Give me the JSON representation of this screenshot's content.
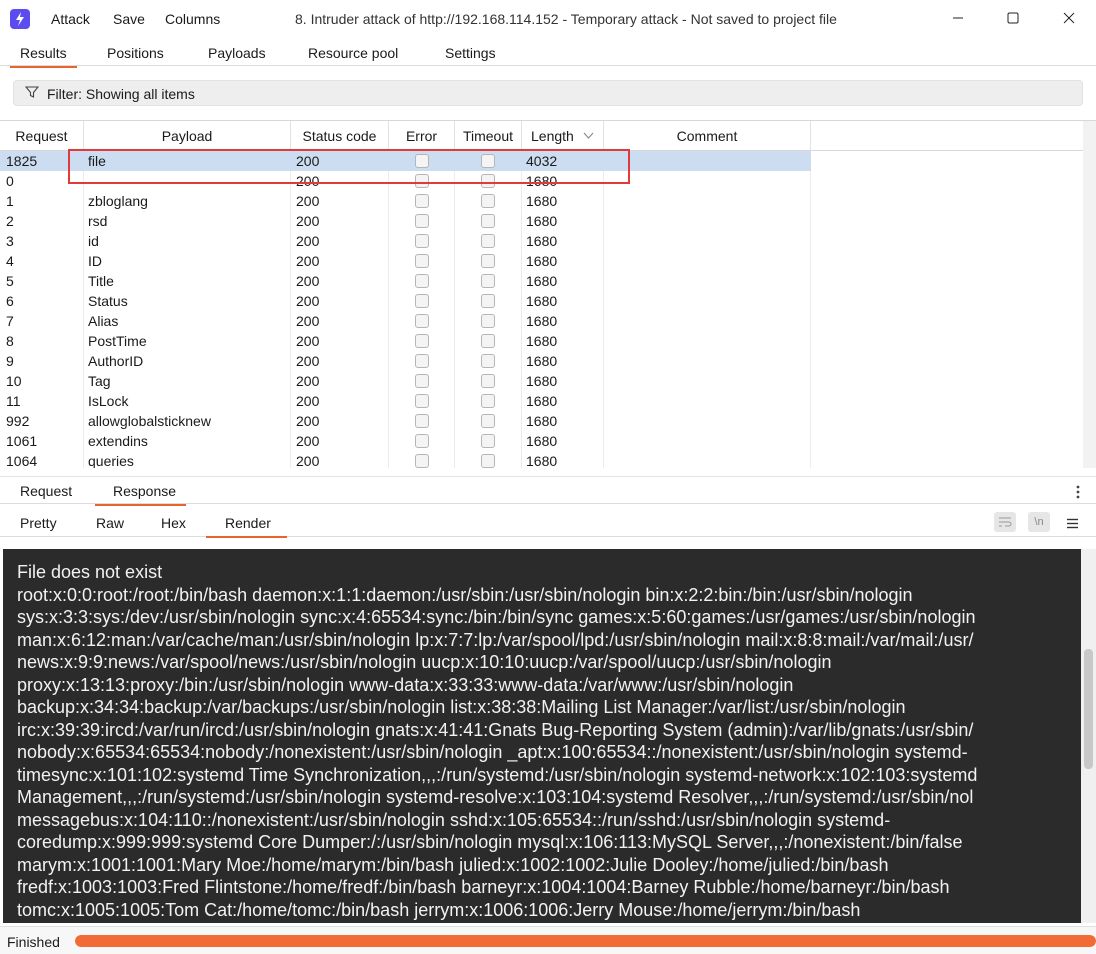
{
  "menu": {
    "attack": "Attack",
    "save": "Save",
    "columns": "Columns"
  },
  "window_title": "8. Intruder attack of http://192.168.114.152 - Temporary attack - Not saved to project file",
  "tabs": [
    "Results",
    "Positions",
    "Payloads",
    "Resource pool",
    "Settings"
  ],
  "active_tab": "Results",
  "filter": {
    "label": "Filter: Showing all items"
  },
  "table": {
    "columns": [
      "Request",
      "Payload",
      "Status code",
      "Error",
      "Timeout",
      "Length",
      "Comment"
    ],
    "sort_column": "Length",
    "rows": [
      {
        "request": "1825",
        "payload": "file",
        "status": "200",
        "length": "4032",
        "selected": true
      },
      {
        "request": "0",
        "payload": "",
        "status": "200",
        "length": "1680"
      },
      {
        "request": "1",
        "payload": "zbloglang",
        "status": "200",
        "length": "1680"
      },
      {
        "request": "2",
        "payload": "rsd",
        "status": "200",
        "length": "1680"
      },
      {
        "request": "3",
        "payload": "id",
        "status": "200",
        "length": "1680"
      },
      {
        "request": "4",
        "payload": "ID",
        "status": "200",
        "length": "1680"
      },
      {
        "request": "5",
        "payload": "Title",
        "status": "200",
        "length": "1680"
      },
      {
        "request": "6",
        "payload": "Status",
        "status": "200",
        "length": "1680"
      },
      {
        "request": "7",
        "payload": "Alias",
        "status": "200",
        "length": "1680"
      },
      {
        "request": "8",
        "payload": "PostTime",
        "status": "200",
        "length": "1680"
      },
      {
        "request": "9",
        "payload": "AuthorID",
        "status": "200",
        "length": "1680"
      },
      {
        "request": "10",
        "payload": "Tag",
        "status": "200",
        "length": "1680"
      },
      {
        "request": "11",
        "payload": "IsLock",
        "status": "200",
        "length": "1680"
      },
      {
        "request": "992",
        "payload": "allowglobalsticknew",
        "status": "200",
        "length": "1680"
      },
      {
        "request": "1061",
        "payload": "extendins",
        "status": "200",
        "length": "1680"
      },
      {
        "request": "1064",
        "payload": "queries",
        "status": "200",
        "length": "1680"
      }
    ]
  },
  "message_tabs": [
    "Request",
    "Response"
  ],
  "active_message_tab": "Response",
  "view_tabs": [
    "Pretty",
    "Raw",
    "Hex",
    "Render"
  ],
  "active_view_tab": "Render",
  "toolbar": {
    "newline_label": "\\n"
  },
  "render_lines": [
    "File does not exist",
    "root:x:0:0:root:/root:/bin/bash daemon:x:1:1:daemon:/usr/sbin:/usr/sbin/nologin bin:x:2:2:bin:/bin:/usr/sbin/nologin",
    "sys:x:3:3:sys:/dev:/usr/sbin/nologin sync:x:4:65534:sync:/bin:/bin/sync games:x:5:60:games:/usr/games:/usr/sbin/nologin",
    "man:x:6:12:man:/var/cache/man:/usr/sbin/nologin lp:x:7:7:lp:/var/spool/lpd:/usr/sbin/nologin mail:x:8:8:mail:/var/mail:/usr/",
    "news:x:9:9:news:/var/spool/news:/usr/sbin/nologin uucp:x:10:10:uucp:/var/spool/uucp:/usr/sbin/nologin",
    "proxy:x:13:13:proxy:/bin:/usr/sbin/nologin www-data:x:33:33:www-data:/var/www:/usr/sbin/nologin",
    "backup:x:34:34:backup:/var/backups:/usr/sbin/nologin list:x:38:38:Mailing List Manager:/var/list:/usr/sbin/nologin",
    "irc:x:39:39:ircd:/var/run/ircd:/usr/sbin/nologin gnats:x:41:41:Gnats Bug-Reporting System (admin):/var/lib/gnats:/usr/sbin/",
    "nobody:x:65534:65534:nobody:/nonexistent:/usr/sbin/nologin _apt:x:100:65534::/nonexistent:/usr/sbin/nologin systemd-",
    "timesync:x:101:102:systemd Time Synchronization,,,:/run/systemd:/usr/sbin/nologin systemd-network:x:102:103:systemd",
    "Management,,,:/run/systemd:/usr/sbin/nologin systemd-resolve:x:103:104:systemd Resolver,,,:/run/systemd:/usr/sbin/nol",
    "messagebus:x:104:110::/nonexistent:/usr/sbin/nologin sshd:x:105:65534::/run/sshd:/usr/sbin/nologin systemd-",
    "coredump:x:999:999:systemd Core Dumper:/:/usr/sbin/nologin mysql:x:106:113:MySQL Server,,,:/nonexistent:/bin/false",
    "marym:x:1001:1001:Mary Moe:/home/marym:/bin/bash julied:x:1002:1002:Julie Dooley:/home/julied:/bin/bash",
    "fredf:x:1003:1003:Fred Flintstone:/home/fredf:/bin/bash barneyr:x:1004:1004:Barney Rubble:/home/barneyr:/bin/bash",
    "tomc:x:1005:1005:Tom Cat:/home/tomc:/bin/bash jerrym:x:1006:1006:Jerry Mouse:/home/jerrym:/bin/bash"
  ],
  "status": {
    "label": "Finished",
    "progress": 1.0
  },
  "colors": {
    "accent": "#e8642c",
    "selection": "#cdddf1",
    "progress": "#f26a35",
    "render_bg": "#2b2b2b",
    "highlight": "#e03a3a"
  },
  "icons": [
    "burp-logo-icon",
    "minimize-icon",
    "maximize-icon",
    "close-icon",
    "filter-icon",
    "sort-desc-icon",
    "kebab-menu-icon",
    "wrap-lines-icon",
    "newline-icon",
    "hamburger-menu-icon"
  ]
}
